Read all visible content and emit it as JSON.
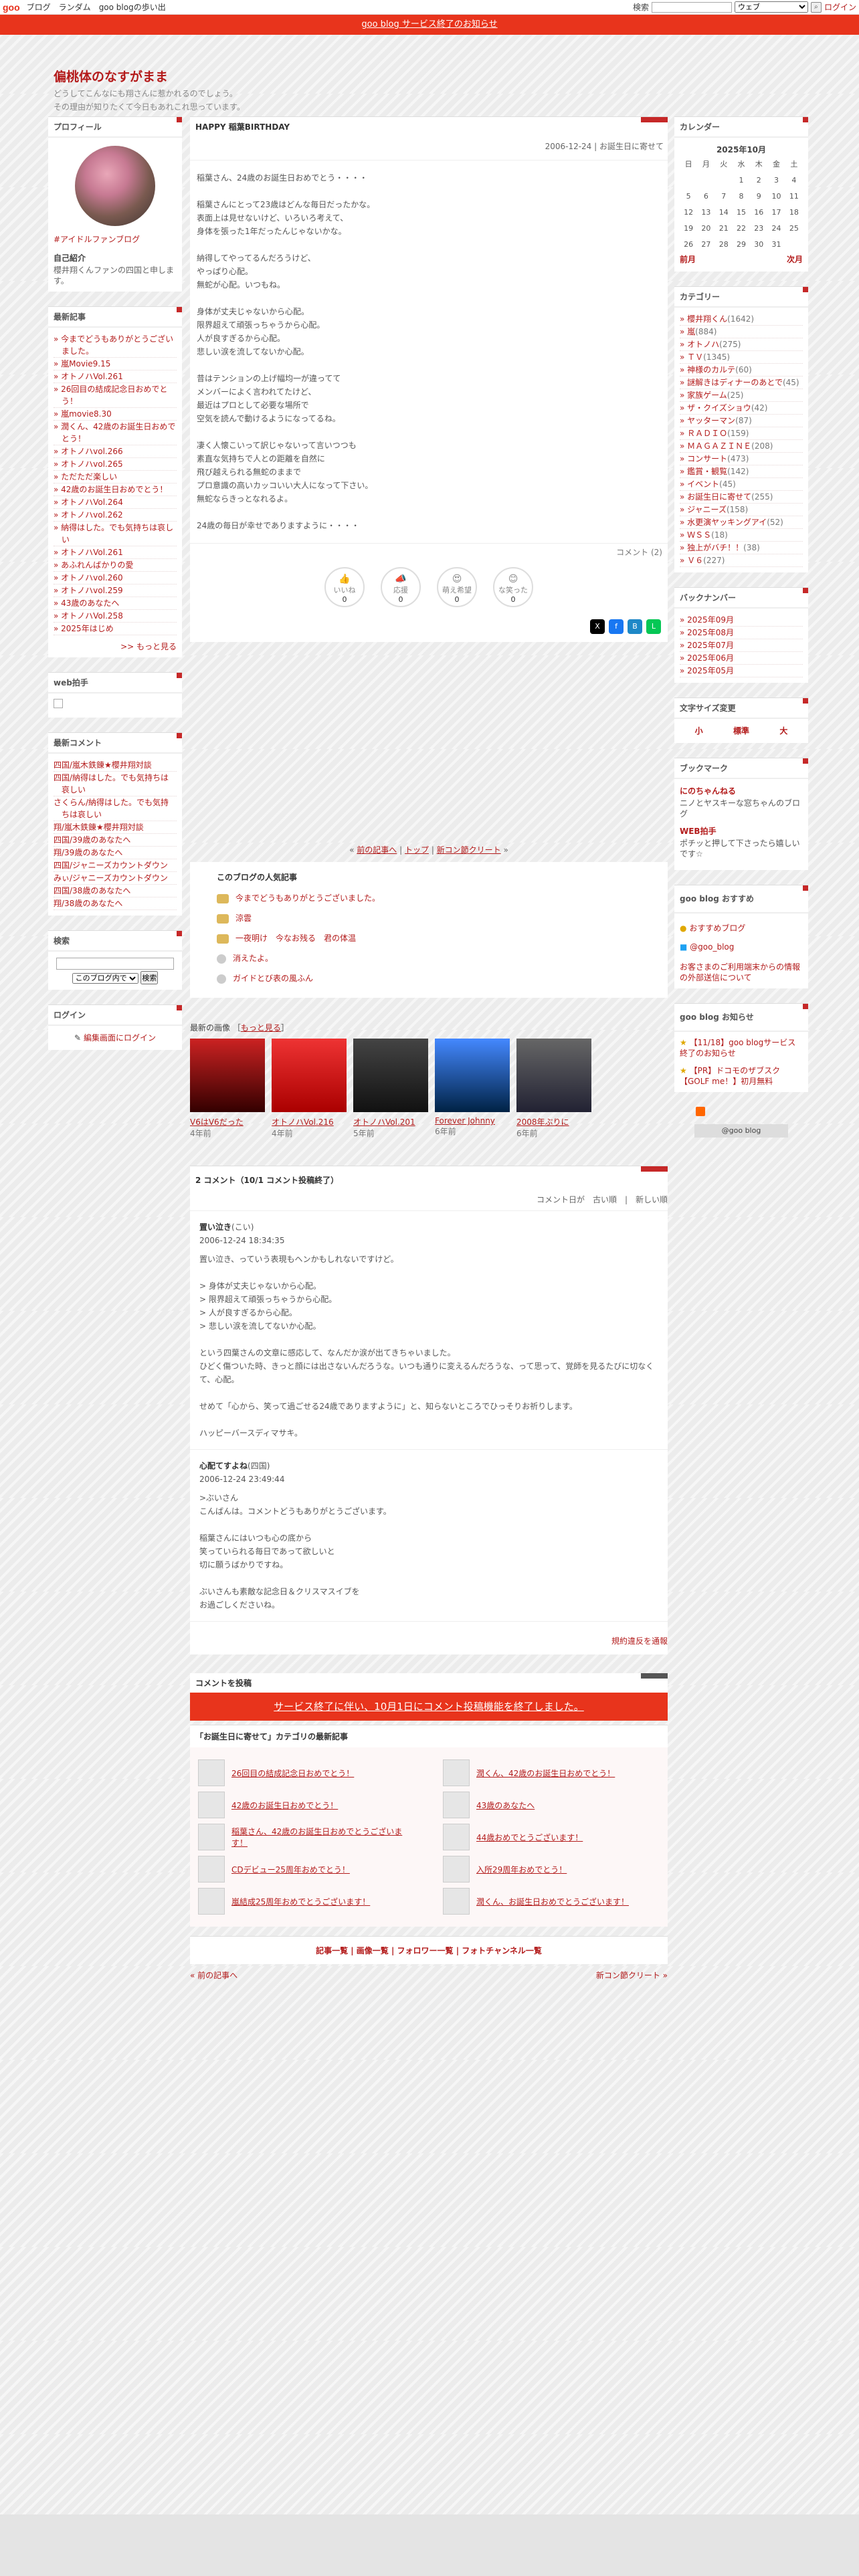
{
  "topbar": {
    "logo": "goo",
    "links": [
      "ブログ",
      "ランダム",
      "goo blogの歩い出"
    ],
    "search_label": "検索",
    "search_select": "ウェブ",
    "login": "ログイン"
  },
  "notice": "goo blog サービス終了のお知らせ",
  "blog": {
    "title": "偏桃体のなすがまま",
    "desc1": "どうしてこんなにも翔さんに惹かれるのでしょう。",
    "desc2": "その理由が知りたくて今日もあれこれ思っています。"
  },
  "profile": {
    "heading": "プロフィール",
    "tag": "#アイドルファンブログ",
    "intro_h": "自己紹介",
    "intro": "櫻井翔くんファンの四国と申します。"
  },
  "recent_posts": {
    "heading": "最新記事",
    "items": [
      "今までどうもありがとうございました。",
      "嵐Movie9.15",
      "オトノハVol.261",
      "26回目の結成記念日おめでとう！",
      "嵐movie8.30",
      "潤くん、42歳のお誕生日おめでとう！",
      "オトノハvol.266",
      "オトノハvol.265",
      "ただただ楽しい",
      "42歳のお誕生日おめでとう！",
      "オトノハVol.264",
      "オトノハvol.262",
      "納得はした。でも気持ちは哀しい",
      "オトノハVol.261",
      "あふれんばかりの愛",
      "オトノハvol.260",
      "オトノハvol.259",
      "43歳のあなたへ",
      "オトノハVol.258",
      "2025年はじめ"
    ],
    "more": ">> もっと見る"
  },
  "webclap": {
    "heading": "web拍手"
  },
  "recent_comments": {
    "heading": "最新コメント",
    "items": [
      "四国/嵐木鉄錬★櫻井翔対談",
      "四国/納得はした。でも気持ちは哀しい",
      "さくらん/納得はした。でも気持ちは哀しい",
      "翔/嵐木鉄錬★櫻井翔対談",
      "四国/39歳のあなたへ",
      "翔/39歳のあなたへ",
      "四国/ジャニーズカウントダウン",
      "みぃ/ジャニーズカウントダウン",
      "四国/38歳のあなたへ",
      "翔/38歳のあなたへ"
    ]
  },
  "search": {
    "heading": "検索",
    "select": "このブログ内で",
    "button": "検索"
  },
  "login": {
    "heading": "ログイン",
    "link": "編集画面にログイン"
  },
  "post": {
    "title": "HAPPY 稲葉BIRTHDAY",
    "date": "2006-12-24 | お誕生日に寄せて",
    "body": "稲葉さん、24歳のお誕生日おめでとう・・・・\n\n稲葉さんにとって23歳はどんな毎日だったかな。\n表面上は見せないけど、いろいろ考えて、\n身体を張った1年だったんじゃないかな。\n\n納得してやってるんだろうけど、\nやっぱり心配。\n無蛇が心配。いつもね。\n\n身体が丈夫じゃないから心配。\n限界超えて頑張っちゃうから心配。\n人が良すぎるから心配。\n悲しい涙を流してないか心配。\n\n昔はテンションの上げ幅均一が違ってて\nメンバーによく言われてたけど、\n最近はプロとして必要な場所で\n空気を読んで動けるようになってるね。\n\n凄く人懐こいって訳じゃないって言いつつも\n素直な気持ちで人との距離を自然に\n飛び越えられる無蛇のままで\nプロ意識の高いカッコいい大人になって下さい。\n無蛇ならきっとなれるよ。\n\n24歳の毎日が幸せでありますように・・・・",
    "comment_count": "コメント (2)",
    "reactions": [
      {
        "t": "いいね",
        "n": "0"
      },
      {
        "t": "応援",
        "n": "0"
      },
      {
        "t": "萌え希望",
        "n": "0"
      },
      {
        "t": "な笑った",
        "n": "0"
      }
    ]
  },
  "navrow": {
    "prev": "前の記事へ",
    "top": "トップ",
    "next": "新コン節クリート"
  },
  "popular": {
    "heading": "このブログの人気記事",
    "items": [
      "今までどうもありがとうございました。",
      "涼雲",
      "一夜明け　今なお残る　君の体温",
      "消えたよ。",
      "ガイドとび表の風ふん"
    ]
  },
  "recent_images": {
    "heading": "最新の画像",
    "more": "もっと見る",
    "items": [
      {
        "t": "V6はV6だった",
        "a": "4年前"
      },
      {
        "t": "オトノハVol.216",
        "a": "4年前"
      },
      {
        "t": "オトノハVol.201",
        "a": "5年前"
      },
      {
        "t": "Forever Johnny",
        "a": "6年前"
      },
      {
        "t": "2008年ぶりに",
        "a": "6年前"
      }
    ]
  },
  "comments": {
    "heading": "2 コメント（10/1 コメント投稿終了）",
    "order": "コメント日が　古い順　|　新しい順",
    "items": [
      {
        "who": "置い泣き",
        "from": "(こい)",
        "date": "2006-12-24 18:34:35",
        "text": "置い泣き、っていう表現もヘンかもしれないですけど。\n\n> 身体が丈夫じゃないから心配。\n> 限界超えて頑張っちゃうから心配。\n> 人が良すぎるから心配。\n> 悲しい涙を流してないか心配。\n\nという四葉さんの文章に感応して、なんだか涙が出てきちゃいました。\nひどく傷ついた時、きっと顔には出さないんだろうな。いつも通りに変えるんだろうな、って思って、覚師を見るたびに切なくて、心配。\n\nせめて「心から、笑って過ごせる24歳でありますように」と、知らないところでひっそりお祈りします。\n\nハッピーバースディマサキ。"
      },
      {
        "who": "心配てすよね",
        "from": "(四国)",
        "date": "2006-12-24 23:49:44",
        "text": ">ぶいさん\nこんばんは。コメントどうもありがとうございます。\n\n稲葉さんにはいつも心の底から\n笑っていられる毎日であって欲しいと\n切に願うばかりですね。\n\nぶいさんも素敵な記念日＆クリスマスイブを\nお過ごしくださいね。"
      }
    ],
    "link": "規約違反を通報"
  },
  "post_comment": {
    "heading": "コメントを投稿",
    "end": "サービス終了に伴い、10月1日にコメント投稿機能を終了しました。"
  },
  "cat_latest": {
    "heading": "「お誕生日に寄せて」カテゴリの最新記事",
    "items": [
      "26回目の結成記念日おめでとう！",
      "潤くん、42歳のお誕生日おめでとう！",
      "42歳のお誕生日おめでとう！",
      "43歳のあなたへ",
      "稲葉さん、42歳のお誕生日おめでとうございます！",
      "44歳おめでとうございます！",
      "CDデビュー25周年おめでとう！",
      "入所29周年おめでとう！",
      "嵐結成25周年おめでとうございます！",
      "潤くん、お誕生日おめでとうございます！"
    ]
  },
  "footnav": {
    "links": "記事一覧 | 画像一覧 | フォロワー一覧 | フォトチャンネル一覧",
    "prev": "« 前の記事へ",
    "next": "新コン節クリート »"
  },
  "calendar": {
    "heading": "カレンダー",
    "month": "2025年10月",
    "days": [
      "日",
      "月",
      "火",
      "水",
      "木",
      "金",
      "土"
    ],
    "rows": [
      [
        "",
        "",
        "",
        "1",
        "2",
        "3",
        "4"
      ],
      [
        "5",
        "6",
        "7",
        "8",
        "9",
        "10",
        "11"
      ],
      [
        "12",
        "13",
        "14",
        "15",
        "16",
        "17",
        "18"
      ],
      [
        "19",
        "20",
        "21",
        "22",
        "23",
        "24",
        "25"
      ],
      [
        "26",
        "27",
        "28",
        "29",
        "30",
        "31",
        ""
      ]
    ],
    "prev": "前月",
    "next": "次月"
  },
  "categories": {
    "heading": "カテゴリー",
    "items": [
      {
        "n": "櫻井翔くん",
        "c": "(1642)"
      },
      {
        "n": "嵐",
        "c": "(884)"
      },
      {
        "n": "オトノハ",
        "c": "(275)"
      },
      {
        "n": "ＴＶ",
        "c": "(1345)"
      },
      {
        "n": "神様のカルテ",
        "c": "(60)"
      },
      {
        "n": "謎解きはディナーのあとで",
        "c": "(45)"
      },
      {
        "n": "家族ゲーム",
        "c": "(25)"
      },
      {
        "n": "ザ・クイズショウ",
        "c": "(42)"
      },
      {
        "n": "ヤッターマン",
        "c": "(87)"
      },
      {
        "n": "ＲＡＤＩＯ",
        "c": "(159)"
      },
      {
        "n": "ＭＡＧＡＺＩＮＥ",
        "c": "(208)"
      },
      {
        "n": "コンサート",
        "c": "(473)"
      },
      {
        "n": "鑑賞・観覧",
        "c": "(142)"
      },
      {
        "n": "イベント",
        "c": "(45)"
      },
      {
        "n": "お誕生日に寄せて",
        "c": "(255)"
      },
      {
        "n": "ジャニーズ",
        "c": "(158)"
      },
      {
        "n": "水更演ヤッキングアイ",
        "c": "(52)"
      },
      {
        "n": "ＷＳＳ",
        "c": "(18)"
      },
      {
        "n": "独上がバチ！！",
        "c": "(38)"
      },
      {
        "n": "Ｖ６",
        "c": "(227)"
      }
    ]
  },
  "backnumber": {
    "heading": "バックナンバー",
    "items": [
      "2025年09月",
      "2025年08月",
      "2025年07月",
      "2025年06月",
      "2025年05月"
    ]
  },
  "fontsize": {
    "heading": "文字サイズ変更",
    "items": [
      "小",
      "標準",
      "大"
    ]
  },
  "bookmark": {
    "heading": "ブックマーク",
    "items": [
      {
        "t": "にのちゃんねる",
        "d": "ニノとヤスキーな窓ちゃんのブログ"
      },
      {
        "t": "WEB拍手",
        "d": "ポチッと押して下さったら嬉しいです☆"
      }
    ]
  },
  "goo": {
    "heading": "goo blog おすすめ",
    "items": [
      "おすすめブログ",
      "@goo_blog"
    ],
    "ext": "お客さまのご利用端末からの情報の外部送信について"
  },
  "oshirase": {
    "heading": "goo blog お知らせ",
    "items": [
      "【11/18】goo blogサービス終了のお知らせ",
      "【PR】ドコモのザブスク【GOLF me！】初月無料"
    ],
    "rss": "@goo blog"
  }
}
